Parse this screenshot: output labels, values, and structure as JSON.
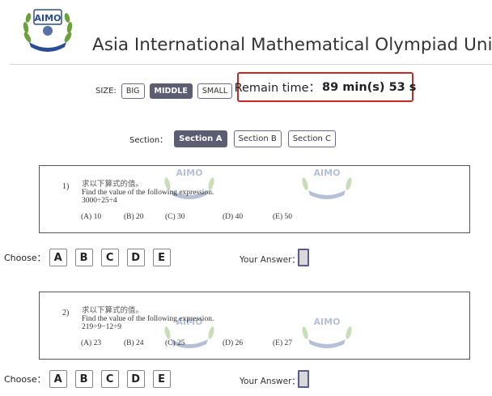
{
  "header": {
    "logo_text": "AIMO",
    "title": "Asia International Mathematical Olympiad Union"
  },
  "size": {
    "label": "SIZE:",
    "options": [
      "BIG",
      "MIDDLE",
      "SMALL"
    ],
    "selected": "MIDDLE"
  },
  "timer": {
    "label": "Remain time：",
    "value": "89 min(s) 53 s",
    "border_color": "#c62828"
  },
  "sections": {
    "label": "Section：",
    "tabs": [
      "Section A",
      "Section B",
      "Section C"
    ],
    "selected": "Section A"
  },
  "questions": [
    {
      "number": "1)",
      "zh": "求以下算式的值。",
      "en": "Find the value of the following expression.",
      "expression": "3000÷25÷4",
      "options": [
        "(A)  10",
        "(B)  20",
        "(C)  30",
        "(D)  40",
        "(E)  50"
      ]
    },
    {
      "number": "2)",
      "zh": "求以下算式的值。",
      "en": "Find the value of the following expression.",
      "expression": "219÷9−12÷9",
      "options": [
        "(A)  23",
        "(B)  24",
        "(C)  25",
        "(D)  26",
        "(E)  27"
      ]
    }
  ],
  "choose": {
    "label": "Choose：",
    "choices": [
      "A",
      "B",
      "C",
      "D",
      "E"
    ],
    "answer_label": "Your Answer："
  },
  "colors": {
    "accent": "#5c5c72",
    "logo_green": "#5a8a2a",
    "logo_blue": "#2a4d8f"
  },
  "icons": {
    "logo": "aimo-laurel-logo-icon",
    "watermark": "aimo-watermark-icon"
  }
}
